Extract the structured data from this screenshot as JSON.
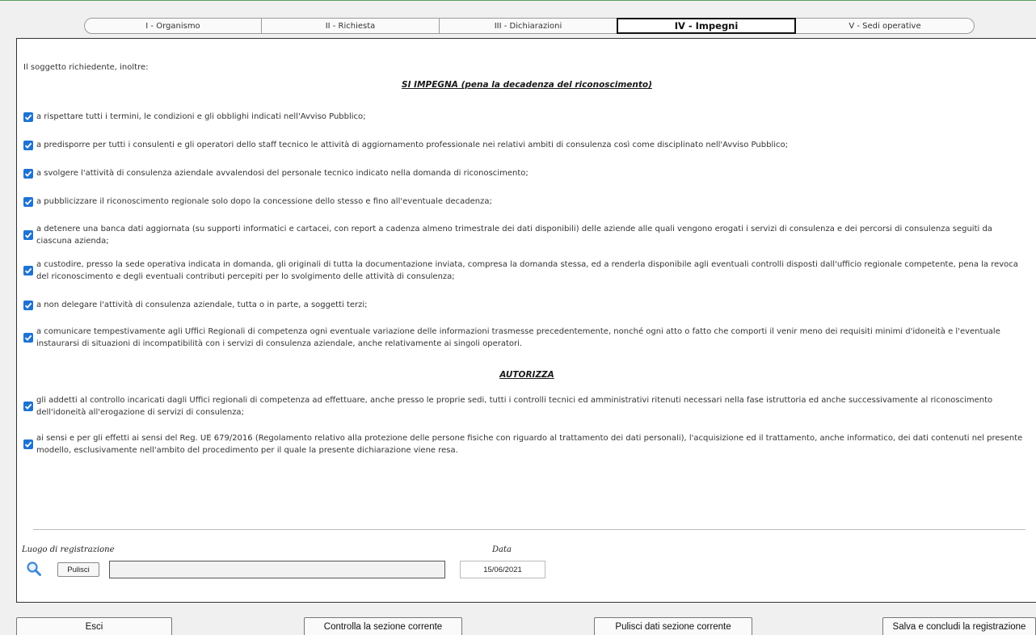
{
  "tabs": [
    {
      "label": "I - Organismo"
    },
    {
      "label": "II - Richiesta"
    },
    {
      "label": "III - Dichiarazioni"
    },
    {
      "label": "IV - Impegni",
      "active": true
    },
    {
      "label": "V - Sedi operative"
    }
  ],
  "intro": "Il soggetto richiedente, inoltre:",
  "heading_impegna": "SI IMPEGNA (pena la decadenza del riconoscimento)",
  "impegni": [
    {
      "text": "a rispettare tutti i termini, le condizioni e gli obblighi indicati nell'Avviso Pubblico;",
      "checked": true
    },
    {
      "text": "a predisporre per tutti i consulenti e gli operatori dello staff tecnico le attività di aggiornamento professionale nei relativi ambiti di consulenza così come disciplinato nell'Avviso Pubblico;",
      "checked": true
    },
    {
      "text": "a svolgere l'attività di consulenza aziendale avvalendosi del personale tecnico indicato nella domanda di riconoscimento;",
      "checked": true
    },
    {
      "text": "a pubblicizzare il riconoscimento regionale solo dopo la concessione dello stesso e fino all'eventuale decadenza;",
      "checked": true
    },
    {
      "text": "a detenere una banca dati aggiornata (su supporti informatici e cartacei, con report a cadenza almeno trimestrale dei dati disponibili) delle aziende alle quali vengono erogati i servizi di consulenza e dei percorsi di consulenza seguiti da ciascuna azienda;",
      "checked": true
    },
    {
      "text": "a custodire, presso la sede operativa indicata in domanda, gli originali di tutta la documentazione inviata, compresa la domanda stessa, ed a renderla disponibile agli eventuali controlli disposti dall'ufficio regionale competente, pena la revoca del riconoscimento e degli eventuali contributi percepiti per lo svolgimento delle attività di consulenza;",
      "checked": true
    },
    {
      "text": "a non delegare l'attività di consulenza aziendale, tutta o in parte, a soggetti terzi;",
      "checked": true
    },
    {
      "text": "a comunicare tempestivamente agli Uffici Regionali di competenza ogni eventuale variazione delle informazioni trasmesse precedentemente, nonché ogni atto o fatto che comporti il venir meno dei requisiti minimi d'idoneità e l'eventuale instaurarsi di situazioni di incompatibilità con i servizi di consulenza aziendale, anche relativamente ai singoli operatori.",
      "checked": true
    }
  ],
  "heading_autorizza": "AUTORIZZA",
  "autorizzazioni": [
    {
      "text": "gli addetti al controllo incaricati dagli Uffici regionali di competenza ad effettuare, anche presso le proprie sedi, tutti i controlli tecnici ed amministrativi ritenuti necessari nella fase istruttoria ed anche successivamente al riconoscimento dell'idoneità all'erogazione di servizi di consulenza;",
      "checked": true
    },
    {
      "text": "ai sensi e per gli effetti ai sensi del Reg. UE 679/2016 (Regolamento relativo alla protezione delle persone fisiche con riguardo al trattamento dei dati personali), l'acquisizione ed il trattamento, anche informatico, dei dati contenuti nel presente modello, esclusivamente nell'ambito del procedimento per il quale la presente dichiarazione viene resa.",
      "checked": true
    }
  ],
  "registration": {
    "luogo_label": "Luogo di registrazione",
    "pulisci_label": "Pulisci",
    "luogo_value": "",
    "data_label": "Data",
    "data_value": "15/06/2021"
  },
  "footer": {
    "esci": "Esci",
    "controlla": "Controlla la sezione corrente",
    "pulisci_dati": "Pulisci dati sezione corrente",
    "salva": "Salva e concludi la registrazione"
  },
  "colors": {
    "checkbox": "#1e73d2",
    "border": "#333333"
  }
}
